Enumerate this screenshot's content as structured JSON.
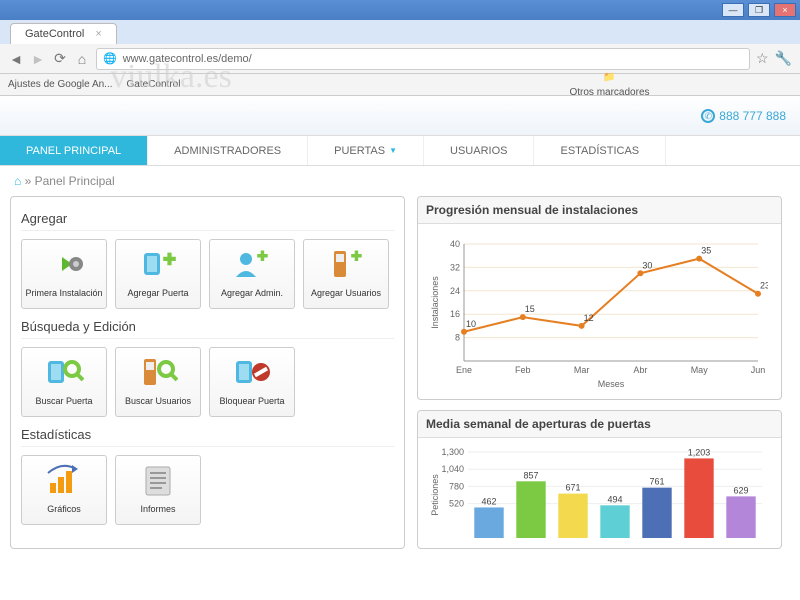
{
  "browser": {
    "tab_title": "GateControl",
    "url": "www.gatecontrol.es/demo/",
    "bookmarks": [
      "Ajustes de Google An...",
      "GateControl"
    ],
    "other_bookmarks": "Otros marcadores"
  },
  "header": {
    "logo_watermark": "viulka.es",
    "phone": "888 777 888"
  },
  "nav": {
    "items": [
      "PANEL PRINCIPAL",
      "ADMINISTRADORES",
      "PUERTAS",
      "USUARIOS",
      "ESTADÍSTICAS"
    ],
    "active_index": 0
  },
  "breadcrumb": "» Panel Principal",
  "sections": {
    "agregar": {
      "title": "Agregar",
      "cards": [
        {
          "label": "Primera Instalación",
          "icon": "arrow-gear"
        },
        {
          "label": "Agregar Puerta",
          "icon": "door-plus"
        },
        {
          "label": "Agregar Admin.",
          "icon": "user-plus"
        },
        {
          "label": "Agregar Usuarios",
          "icon": "phone-plus"
        }
      ]
    },
    "busqueda": {
      "title": "Búsqueda y Edición",
      "cards": [
        {
          "label": "Buscar Puerta",
          "icon": "door-search"
        },
        {
          "label": "Buscar Usuarios",
          "icon": "phone-search"
        },
        {
          "label": "Bloquear Puerta",
          "icon": "door-block"
        }
      ]
    },
    "estadisticas": {
      "title": "Estadísticas",
      "cards": [
        {
          "label": "Gráficos",
          "icon": "bars-arrow"
        },
        {
          "label": "Informes",
          "icon": "report"
        }
      ]
    }
  },
  "chart_data": [
    {
      "type": "line",
      "title": "Progresión mensual de instalaciones",
      "xlabel": "Meses",
      "ylabel": "Instalaciones",
      "ylim": [
        0,
        40
      ],
      "yticks": [
        8,
        16,
        24,
        32,
        40
      ],
      "x": [
        "Ene",
        "Feb",
        "Mar",
        "Abr",
        "May",
        "Jun"
      ],
      "values": [
        10,
        15,
        12,
        30,
        35,
        23
      ]
    },
    {
      "type": "bar",
      "title": "Media semanal de aperturas de puertas",
      "ylabel": "Peticiones",
      "ylim": [
        0,
        1300
      ],
      "yticks": [
        520,
        780,
        1040,
        1300
      ],
      "categories": [
        "",
        "",
        "",
        "",
        "",
        "",
        ""
      ],
      "values": [
        462,
        857,
        671,
        494,
        761,
        1203,
        629
      ],
      "colors": [
        "#6aa8e0",
        "#7cc943",
        "#f2d94e",
        "#5fcfd6",
        "#4c6fb5",
        "#e74c3c",
        "#b486d9"
      ]
    }
  ]
}
